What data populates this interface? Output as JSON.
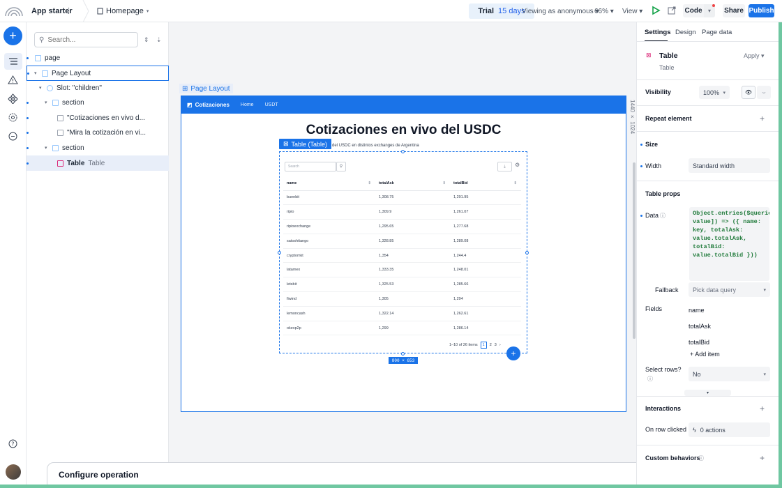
{
  "topbar": {
    "app_name": "App starter",
    "app_menu": "⋮",
    "page": "Homepage",
    "trial_label": "Trial",
    "trial_days": "15 days",
    "viewing_as": "Viewing as anonymous",
    "zoom": "66%",
    "view": "View",
    "code": "Code",
    "share": "Share",
    "publish": "Publish"
  },
  "tree": {
    "search_placeholder": "Search...",
    "rows": [
      {
        "label": "page",
        "muted": ""
      },
      {
        "label": "Page Layout",
        "muted": ""
      },
      {
        "label": "Slot: \"children\"",
        "muted": ""
      },
      {
        "label": "section",
        "muted": ""
      },
      {
        "label": "\"Cotizaciones en vivo d...",
        "muted": ""
      },
      {
        "label": "\"Mira la cotización en vi...",
        "muted": ""
      },
      {
        "label": "section",
        "muted": ""
      },
      {
        "label": "Table",
        "muted": "Table"
      }
    ]
  },
  "canvas": {
    "frame_label": "Page Layout",
    "nav_brand": "Cotizaciones",
    "nav_links": [
      "Home",
      "USDT"
    ],
    "title": "Cotizaciones en vivo del USDC",
    "subtitle": "del USDC en distintos exchanges de Argentina",
    "tag": "Table (Table)",
    "search_placeholder": "Search",
    "headers": [
      "name",
      "totalAsk",
      "totalBid"
    ],
    "rows": [
      [
        "buenbit",
        "1,308.75",
        "1,291.95"
      ],
      [
        "ripio",
        "1,309.9",
        "1,261.07"
      ],
      [
        "ripioexchange",
        "1,295.65",
        "1,277.68"
      ],
      [
        "satoshitango",
        "1,328.85",
        "1,289.08"
      ],
      [
        "cryptomkt",
        "1,354",
        "1,244.4"
      ],
      [
        "latamex",
        "1,333.35",
        "1,248.01"
      ],
      [
        "letsbit",
        "1,325.53",
        "1,285.66"
      ],
      [
        "fiwind",
        "1,305",
        "1,294"
      ],
      [
        "lemoncash",
        "1,322.14",
        "1,262.61"
      ],
      [
        "okexp2p",
        "1,299",
        "1,286.14"
      ]
    ],
    "pager_text": "1–10 of 26 items",
    "pages": [
      "1",
      "2",
      "3"
    ],
    "size_badge": "800 × 653",
    "ruler": "1440 × 1024",
    "config_title": "Configure operation"
  },
  "panel": {
    "tabs": [
      "Settings",
      "Design",
      "Page data"
    ],
    "element_name": "Table",
    "element_type": "Table",
    "apply": "Apply",
    "visibility": "Visibility",
    "visibility_value": "100%",
    "repeat": "Repeat element",
    "size": "Size",
    "width_label": "Width",
    "width_value": "Standard width",
    "table_props": "Table props",
    "data_label": "Data",
    "data_code": "Object.entries($queries.cotizacionesUsdc.data.response).map(([key, value]) => ({ name: key, totalAsk: value.totalAsk, totalBid: value.totalBid }))",
    "fallback_label": "Fallback",
    "fallback_value": "Pick data query",
    "fields_label": "Fields",
    "fields": [
      "name",
      "totalAsk",
      "totalBid"
    ],
    "add_item": "Add item",
    "select_rows_label": "Select rows?",
    "select_rows_value": "No",
    "interactions": "Interactions",
    "on_row_clicked": "On row clicked",
    "actions": "0 actions",
    "custom_behaviors": "Custom behaviors"
  }
}
